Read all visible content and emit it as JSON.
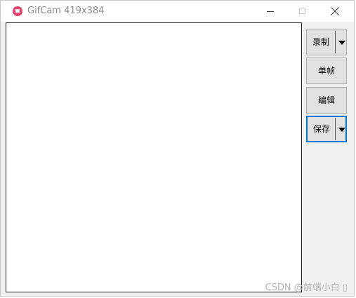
{
  "window": {
    "title": "GifCam 419x384"
  },
  "toolbar": {
    "record_label": "录制",
    "frame_label": "单帧",
    "edit_label": "编辑",
    "save_label": "保存"
  },
  "watermark": "CSDN @前端小白 ▯",
  "colors": {
    "app_icon": "#e9436b",
    "focus_border": "#0078d7"
  }
}
